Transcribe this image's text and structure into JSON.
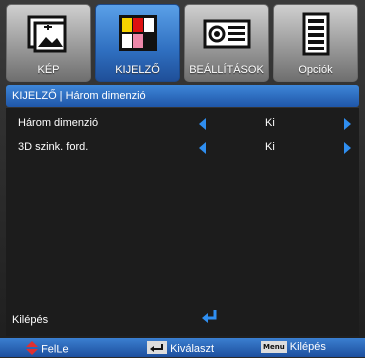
{
  "tabs": [
    {
      "label": "KÉP",
      "icon": "picture-icon",
      "active": false
    },
    {
      "label": "KIJELZŐ",
      "icon": "display-icon",
      "active": true
    },
    {
      "label": "BEÁLLÍTÁSOK",
      "icon": "projector-icon",
      "active": false
    },
    {
      "label": "Opciók",
      "icon": "options-icon",
      "active": false
    }
  ],
  "header": {
    "title": "KIJELZŐ | Három dimenzió"
  },
  "rows": [
    {
      "label": "Három dimenzió",
      "value": "Ki"
    },
    {
      "label": "3D szink. ford.",
      "value": "Ki"
    }
  ],
  "exit": {
    "label": "Kilépés"
  },
  "footer": {
    "updown_label": "FelLe",
    "select_label": "Kiválaszt",
    "menu_key": "Menu",
    "exit_label": "Kilépés"
  },
  "colors": {
    "accent": "#2f6fc0",
    "arrow": "#2f8ef0",
    "enter": "#2f8ef0",
    "updown": "#e03030"
  }
}
